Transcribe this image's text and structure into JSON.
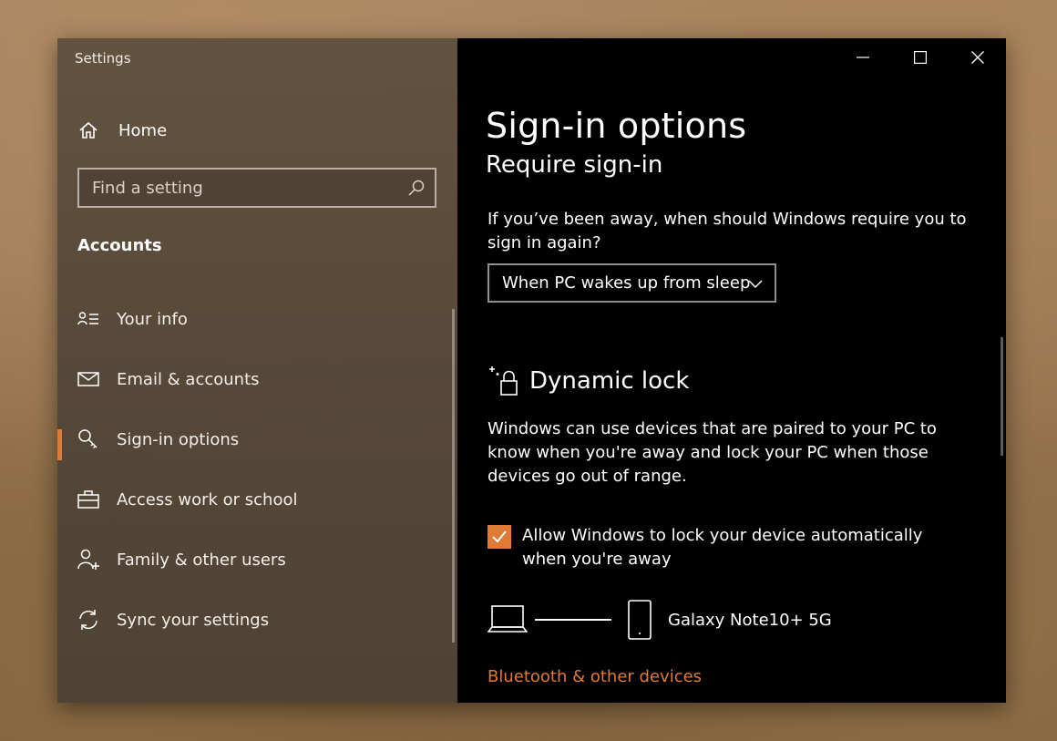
{
  "window": {
    "app_title": "Settings",
    "controls": {
      "minimize": "minimize-icon",
      "maximize": "maximize-icon",
      "close": "close-icon"
    }
  },
  "sidebar": {
    "home_label": "Home",
    "search_placeholder": "Find a setting",
    "section_title": "Accounts",
    "items": [
      {
        "label": "Your info",
        "icon": "contact-info-icon",
        "active": false
      },
      {
        "label": "Email & accounts",
        "icon": "mail-icon",
        "active": false
      },
      {
        "label": "Sign-in options",
        "icon": "key-icon",
        "active": true
      },
      {
        "label": "Access work or school",
        "icon": "briefcase-icon",
        "active": false
      },
      {
        "label": "Family & other users",
        "icon": "add-person-icon",
        "active": false
      },
      {
        "label": "Sync your settings",
        "icon": "sync-icon",
        "active": false
      }
    ]
  },
  "main": {
    "page_title": "Sign-in options",
    "require_signin": {
      "title": "Require sign-in",
      "prompt": "If you’ve been away, when should Windows require you to sign in again?",
      "dropdown_value": "When PC wakes up from sleep"
    },
    "dynamic_lock": {
      "title": "Dynamic lock",
      "description": "Windows can use devices that are paired to your PC to know when you're away and lock your PC when those devices go out of range.",
      "checkbox_label": "Allow Windows to lock your device automatically when you're away",
      "checkbox_checked": true,
      "device_name": "Galaxy Note10+ 5G"
    },
    "bluetooth_link": "Bluetooth & other devices"
  },
  "colors": {
    "accent": "#e07a34",
    "sidebar_bg": "#5a4b3c",
    "content_bg": "#000000"
  }
}
